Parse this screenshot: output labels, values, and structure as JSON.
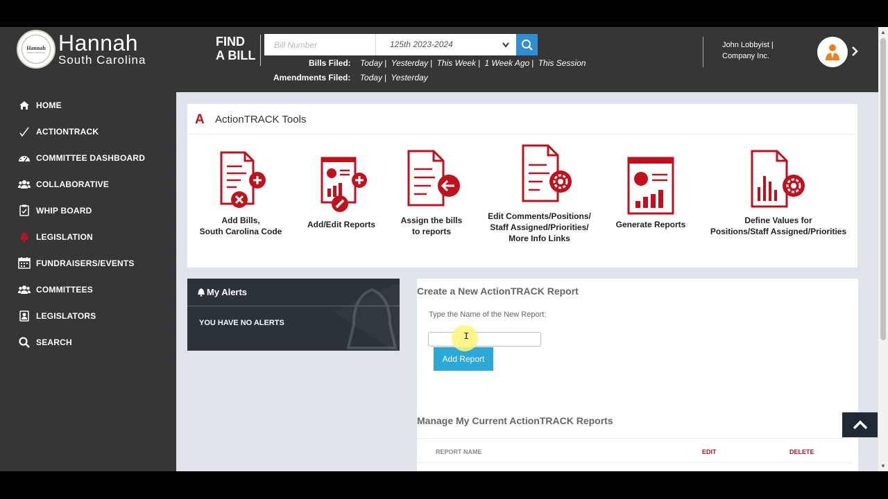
{
  "logo": {
    "name": "Hannah",
    "state": "South Carolina",
    "seal_name": "Hannah",
    "seal_sub": "NEWS SERVICE"
  },
  "find_bill": {
    "line1": "FIND",
    "line2": "A BILL",
    "placeholder": "Bill Number",
    "session": "125th 2023-2024"
  },
  "bills_filed": {
    "label": "Bills Filed:",
    "links": [
      "Today",
      "Yesterday",
      "This Week",
      "1 Week Ago",
      "This Session"
    ]
  },
  "amendments_filed": {
    "label": "Amendments Filed:",
    "links": [
      "Today",
      "Yesterday"
    ]
  },
  "user": {
    "name_line1": "John Lobbyist |",
    "name_line2": "Company Inc."
  },
  "sidebar": {
    "items": [
      {
        "label": "HOME",
        "icon": "home-icon"
      },
      {
        "label": "ACTIONTRACK",
        "icon": "check-icon"
      },
      {
        "label": "COMMITTEE DASHBOARD",
        "icon": "dashboard-icon"
      },
      {
        "label": "COLLABORATIVE",
        "icon": "people-icon"
      },
      {
        "label": "WHIP BOARD",
        "icon": "clipboard-icon"
      },
      {
        "label": "LEGISLATION",
        "icon": "bell-icon"
      },
      {
        "label": "FUNDRAISERS/EVENTS",
        "icon": "calendar-icon"
      },
      {
        "label": "COMMITTEES",
        "icon": "people-icon"
      },
      {
        "label": "LEGISLATORS",
        "icon": "id-card-icon"
      },
      {
        "label": "SEARCH",
        "icon": "search-icon"
      }
    ]
  },
  "tools": {
    "logo": "A",
    "title": "ActionTRACK Tools",
    "items": [
      {
        "line1": "Add Bills,",
        "line2": "South Carolina Code",
        "line3": "",
        "line4": ""
      },
      {
        "line1": "Add/Edit Reports",
        "line2": "",
        "line3": "",
        "line4": ""
      },
      {
        "line1": "Assign the bills",
        "line2": "to reports",
        "line3": "",
        "line4": ""
      },
      {
        "line1": "Edit Comments/Positions/",
        "line2": "Staff Assigned/Priorities/",
        "line3": "More Info Links",
        "line4": ""
      },
      {
        "line1": "Generate Reports",
        "line2": "",
        "line3": "",
        "line4": ""
      },
      {
        "line1": "Define Values for",
        "line2": "Positions/Staff Assigned/Priorities",
        "line3": "",
        "line4": ""
      }
    ]
  },
  "alerts": {
    "title": "My Alerts",
    "message": "YOU HAVE NO ALERTS"
  },
  "create_report": {
    "title": "Create a New ActionTRACK Report",
    "label": "Type the Name of the New Report:",
    "value": "",
    "button": "Add Report"
  },
  "manage_reports": {
    "title": "Manage My Current ActionTRACK Reports",
    "columns": [
      "REPORT NAME",
      "EDIT",
      "DELETE"
    ]
  },
  "colors": {
    "accent_red": "#c0121c",
    "button_blue": "#2ba8d8",
    "header_bg": "#363636"
  }
}
